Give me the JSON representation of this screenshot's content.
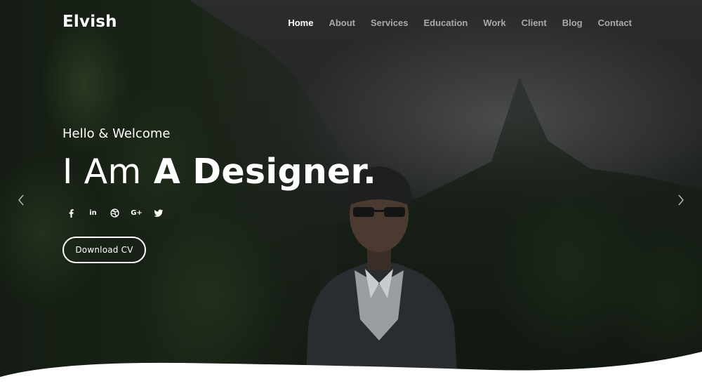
{
  "brand": {
    "logo": "Elvish"
  },
  "nav": {
    "items": [
      {
        "label": "Home",
        "active": true
      },
      {
        "label": "About",
        "active": false
      },
      {
        "label": "Services",
        "active": false
      },
      {
        "label": "Education",
        "active": false
      },
      {
        "label": "Work",
        "active": false
      },
      {
        "label": "Client",
        "active": false
      },
      {
        "label": "Blog",
        "active": false
      },
      {
        "label": "Contact",
        "active": false
      }
    ]
  },
  "hero": {
    "greeting": "Hello & Welcome",
    "headline_light": "I Am",
    "headline_bold": "A Designer.",
    "cta_label": "Download CV",
    "social_icons": [
      "facebook-icon",
      "linkedin-icon",
      "dribbble-icon",
      "google-plus-icon",
      "twitter-icon"
    ],
    "social_text": {
      "linkedin": "in",
      "googleplus": "G+"
    }
  },
  "slider": {
    "prev_icon": "chevron-left-icon",
    "next_icon": "chevron-right-icon"
  },
  "colors": {
    "nav_active": "#ffffff",
    "nav_inactive": "#a9a9a9",
    "text": "#ffffff",
    "wave": "#ffffff"
  }
}
